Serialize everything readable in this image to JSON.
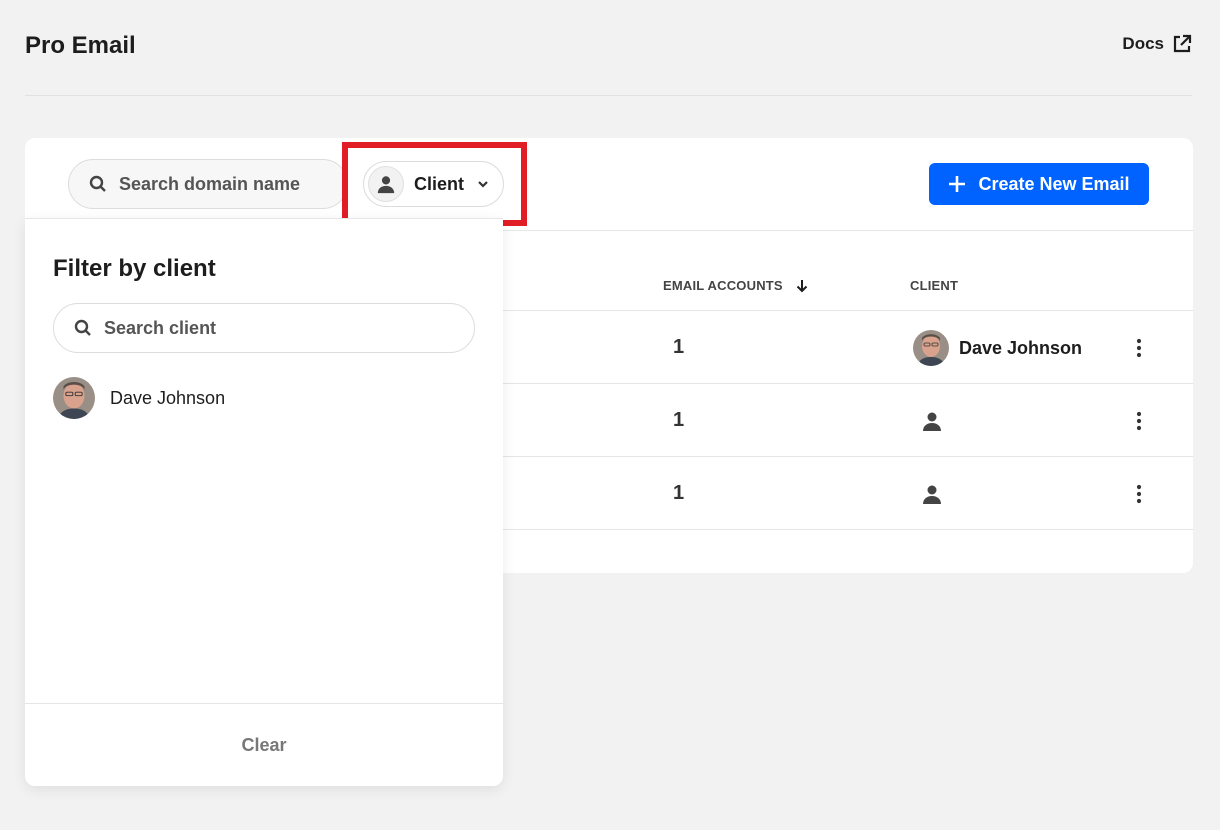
{
  "header": {
    "title": "Pro Email",
    "docs_label": "Docs"
  },
  "toolbar": {
    "search_placeholder": "Search domain name",
    "client_filter_label": "Client",
    "create_button_label": "Create New Email"
  },
  "table": {
    "columns": {
      "email_accounts": "EMAIL ACCOUNTS",
      "client": "CLIENT"
    },
    "rows": [
      {
        "email_accounts": "1",
        "client": "Dave Johnson"
      },
      {
        "email_accounts": "1",
        "client": ""
      },
      {
        "email_accounts": "1",
        "client": ""
      }
    ]
  },
  "filter_panel": {
    "title": "Filter by client",
    "search_placeholder": "Search client",
    "clients": [
      {
        "name": "Dave Johnson"
      }
    ],
    "clear_label": "Clear"
  },
  "colors": {
    "primary": "#0062ff",
    "highlight": "#e11d26",
    "background": "#f2f2f2"
  }
}
